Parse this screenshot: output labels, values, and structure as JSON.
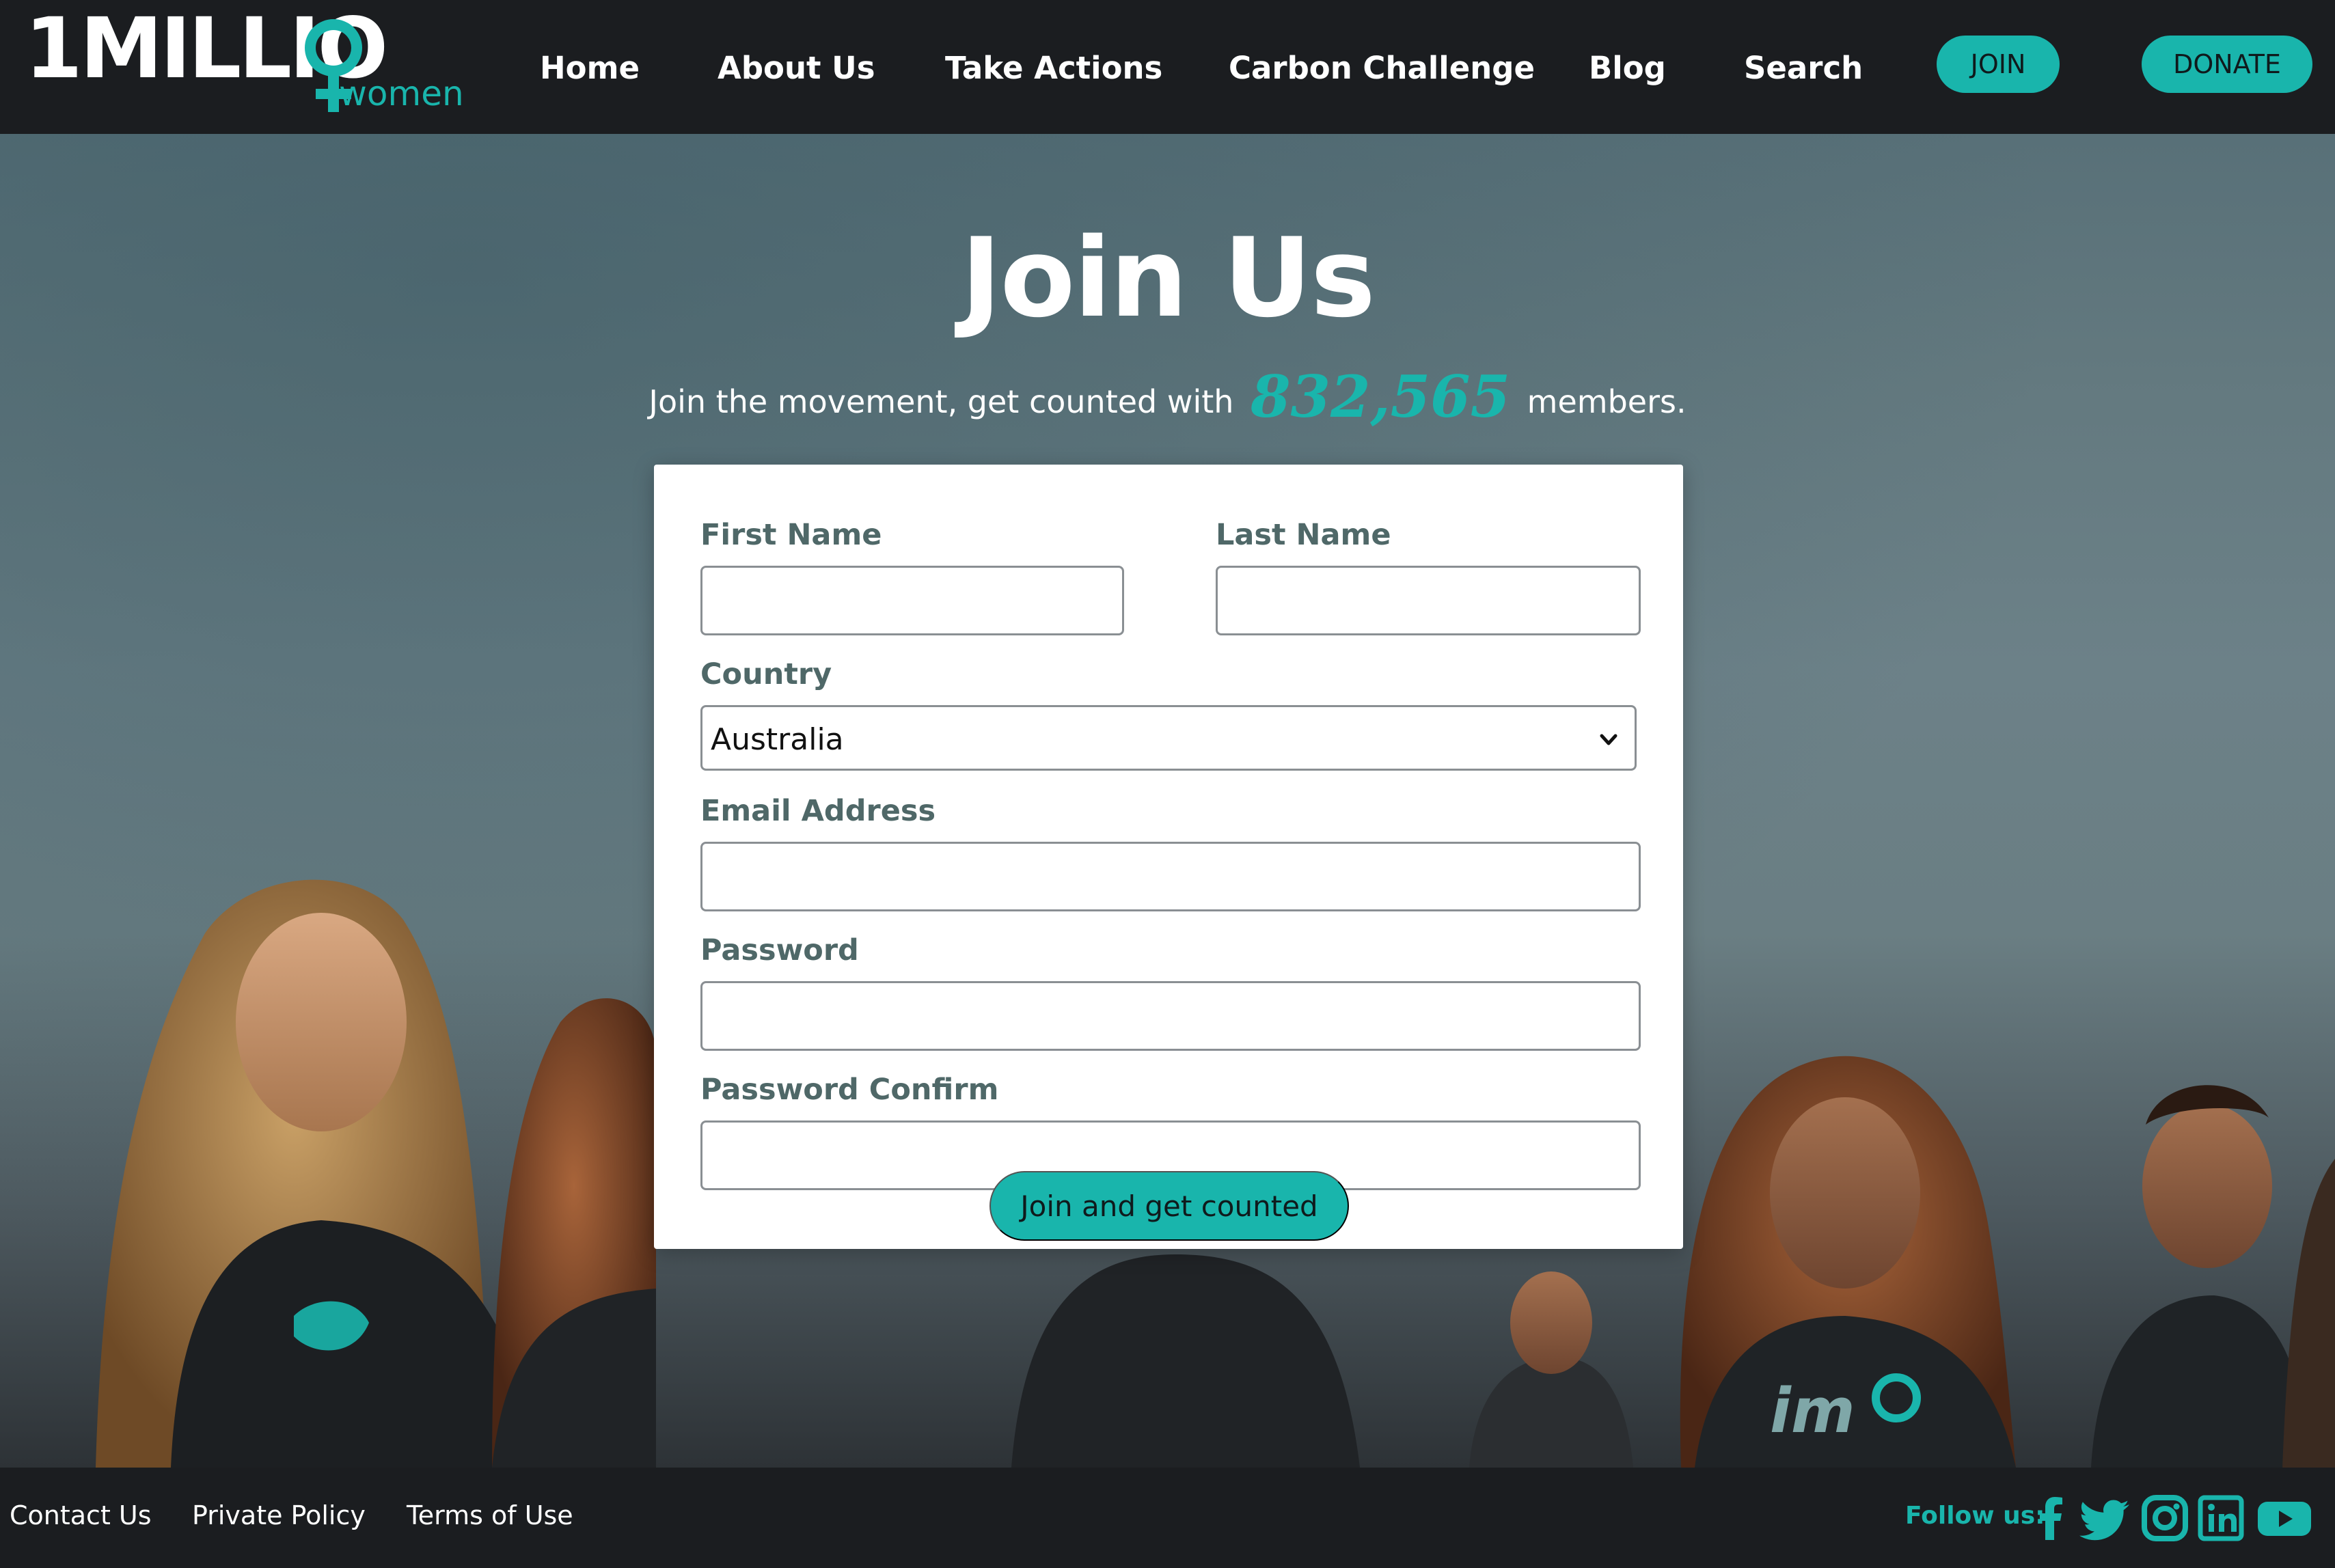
{
  "brand": {
    "logo_main": "1MILLIO",
    "logo_sub": "women",
    "accent": "#19b5ac",
    "dark": "#1b1d20"
  },
  "nav": {
    "items": [
      "Home",
      "About Us",
      "Take Actions",
      "Carbon Challenge",
      "Blog",
      "Search"
    ],
    "join_label": "JOIN",
    "donate_label": "DONATE"
  },
  "hero": {
    "title": "Join Us",
    "subtitle_before": "Join the movement, get counted with",
    "member_count": "832,565",
    "subtitle_after": "members."
  },
  "form": {
    "first_name_label": "First Name",
    "first_name_value": "",
    "last_name_label": "Last Name",
    "last_name_value": "",
    "country_label": "Country",
    "country_value": "Australia",
    "email_label": "Email Address",
    "email_value": "",
    "password_label": "Password",
    "password_value": "",
    "password_confirm_label": "Password Confirm",
    "password_confirm_value": "",
    "submit_label": "Join and get counted"
  },
  "footer": {
    "links": [
      "Contact Us",
      "Private Policy",
      "Terms of Use"
    ],
    "follow_label": "Follow us:",
    "social_icons": [
      "facebook-icon",
      "twitter-icon",
      "instagram-icon",
      "linkedin-icon",
      "youtube-icon"
    ]
  }
}
